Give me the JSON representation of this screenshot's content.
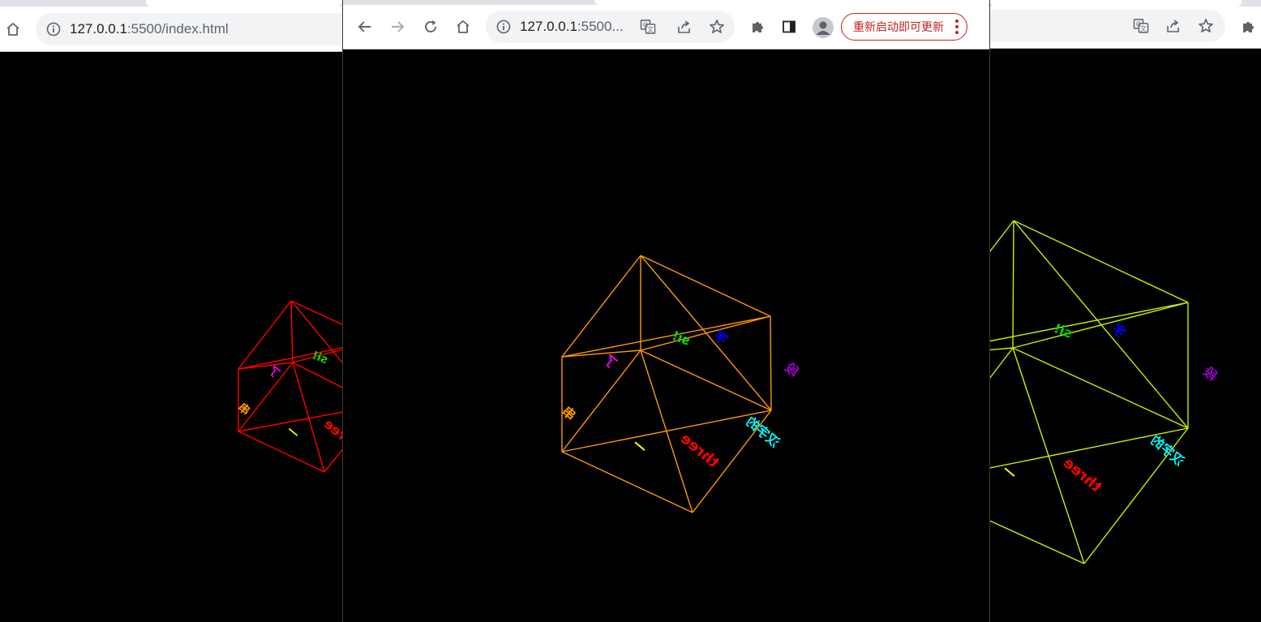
{
  "windows": [
    {
      "url_host": "127.0.0.1",
      "url_rest": ":5500/index.html",
      "cube_color": "#ff0000"
    },
    {
      "url_host": "127.0.0.1",
      "url_rest": ":5500...",
      "cube_color": "#ff9900",
      "update_button": "重新启动即可更新"
    },
    {
      "cube_color": "#ccee00"
    }
  ],
  "labels": {
    "green": "si!",
    "blue": "字",
    "magenta": "了",
    "purple": "段",
    "orange": "串",
    "yellow": "一",
    "red": "three",
    "cyan": "汉字的"
  },
  "colors": {
    "green": "#00dd00",
    "blue": "#0000ff",
    "magenta": "#ff00ff",
    "purple": "#9900cc",
    "orange": "#ff9900",
    "yellow": "#ffff00",
    "red": "#ff0000",
    "cyan": "#00ffff"
  },
  "icons": [
    "home-icon",
    "info-icon",
    "back-arrow-icon",
    "forward-arrow-icon",
    "reload-icon",
    "translate-icon",
    "share-icon",
    "star-icon",
    "extensions-icon",
    "sidepanel-icon",
    "profile-avatar-icon",
    "more-vert-icon"
  ]
}
